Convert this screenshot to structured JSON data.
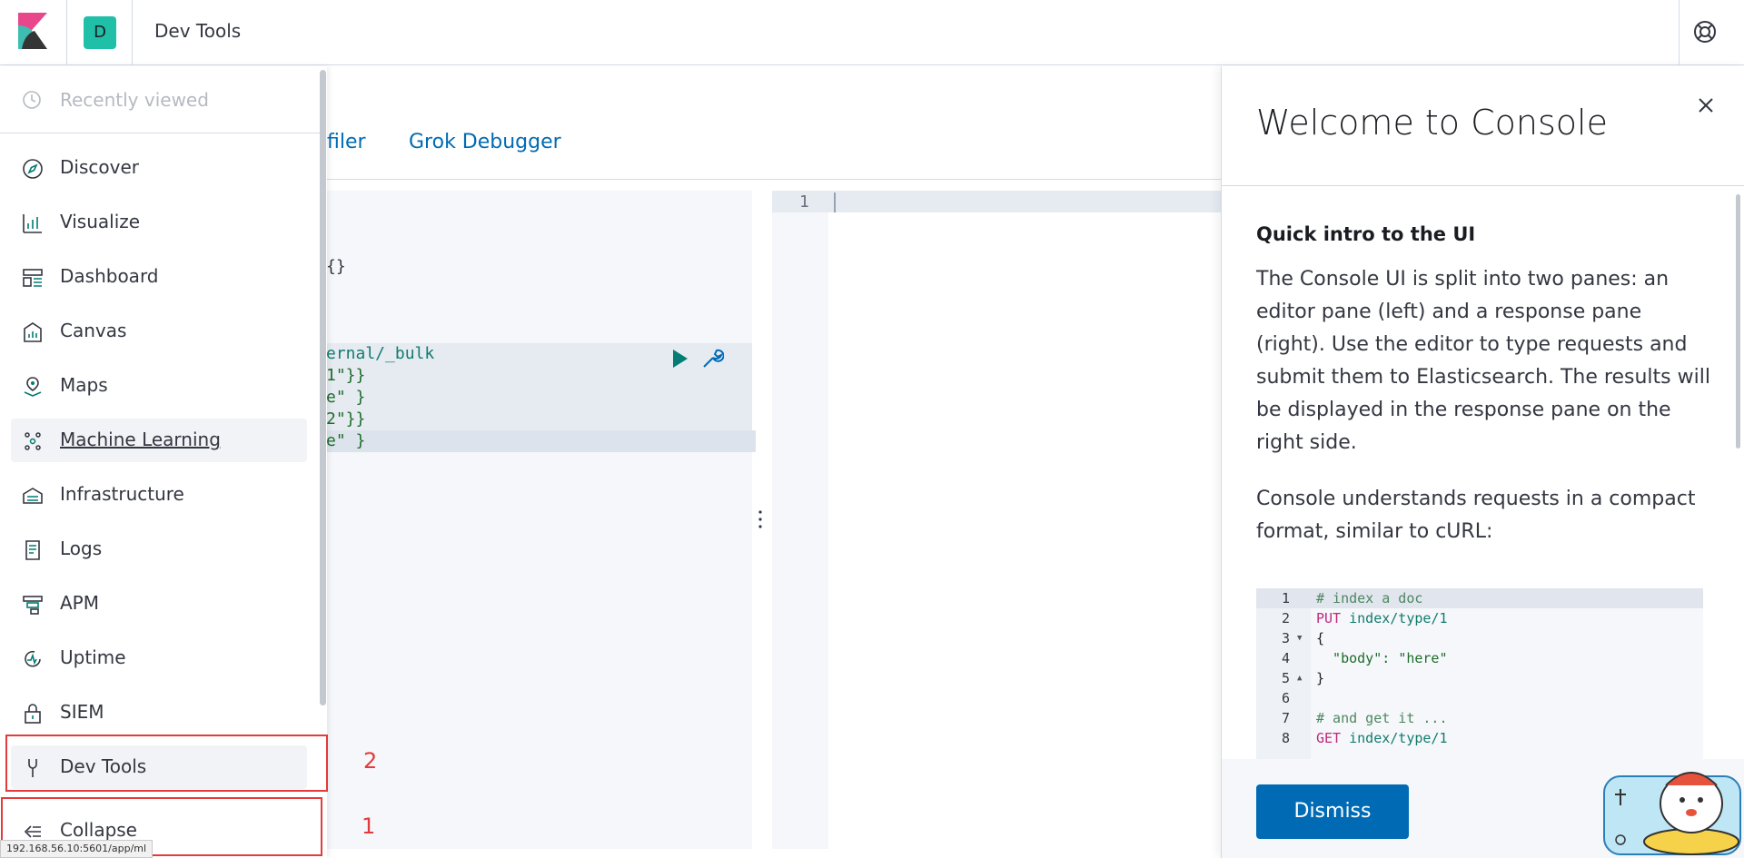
{
  "header": {
    "space_initial": "D",
    "title": "Dev Tools"
  },
  "tabs": {
    "profiler_label": "filer",
    "grok_label": "Grok Debugger"
  },
  "editor": {
    "lines": [
      {
        "text": "{}",
        "color": "#343741"
      },
      {
        "text": "ernal/_bulk",
        "color": "#127b6f"
      },
      {
        "text": "1\"}}",
        "color": "#1e6d2b"
      },
      {
        "text": "e\" }",
        "color": "#1e6d2b"
      },
      {
        "text": "2\"}}",
        "color": "#1e6d2b"
      },
      {
        "text": "e\" }",
        "color": "#1e6d2b"
      }
    ]
  },
  "response": {
    "line_number": "1"
  },
  "nav": {
    "recently_viewed": "Recently viewed",
    "items": [
      {
        "label": "Discover",
        "icon": "compass-icon"
      },
      {
        "label": "Visualize",
        "icon": "visualize-icon"
      },
      {
        "label": "Dashboard",
        "icon": "dashboard-icon"
      },
      {
        "label": "Canvas",
        "icon": "canvas-icon"
      },
      {
        "label": "Maps",
        "icon": "maps-icon"
      },
      {
        "label": "Machine Learning",
        "icon": "machine-learning-icon"
      },
      {
        "label": "Infrastructure",
        "icon": "infrastructure-icon"
      },
      {
        "label": "Logs",
        "icon": "logs-icon"
      },
      {
        "label": "APM",
        "icon": "apm-icon"
      },
      {
        "label": "Uptime",
        "icon": "uptime-icon"
      },
      {
        "label": "SIEM",
        "icon": "siem-icon"
      },
      {
        "label": "Dev Tools",
        "icon": "wrench-icon"
      }
    ],
    "collapse_label": "Collapse"
  },
  "annotations": {
    "box1": "1",
    "box2": "2"
  },
  "url_tooltip": "192.168.56.10:5601/app/ml",
  "flyout": {
    "title": "Welcome to Console",
    "section_heading": "Quick intro to the UI",
    "paragraph1": "The Console UI is split into two panes: an editor pane (left) and a response pane (right). Use the editor to type requests and submit them to Elasticsearch. The results will be displayed in the response pane on the right side.",
    "paragraph2": "Console understands requests in a compact format, similar to cURL:",
    "code": [
      {
        "n": "1",
        "text": "# index a doc"
      },
      {
        "n": "2",
        "method": "PUT",
        "url": " index/type/1"
      },
      {
        "n": "3",
        "text": "{"
      },
      {
        "n": "4",
        "key": "  \"body\": ",
        "value": "\"here\""
      },
      {
        "n": "5",
        "text": "}"
      },
      {
        "n": "6",
        "text": ""
      },
      {
        "n": "7",
        "text": "# and get it ..."
      },
      {
        "n": "8",
        "method": "GET",
        "url": " index/type/1"
      }
    ],
    "dismiss_label": "Dismiss"
  },
  "colors": {
    "accent": "#006bb4",
    "annotation": "#e23b3b",
    "space_avatar": "#20bfa8"
  }
}
